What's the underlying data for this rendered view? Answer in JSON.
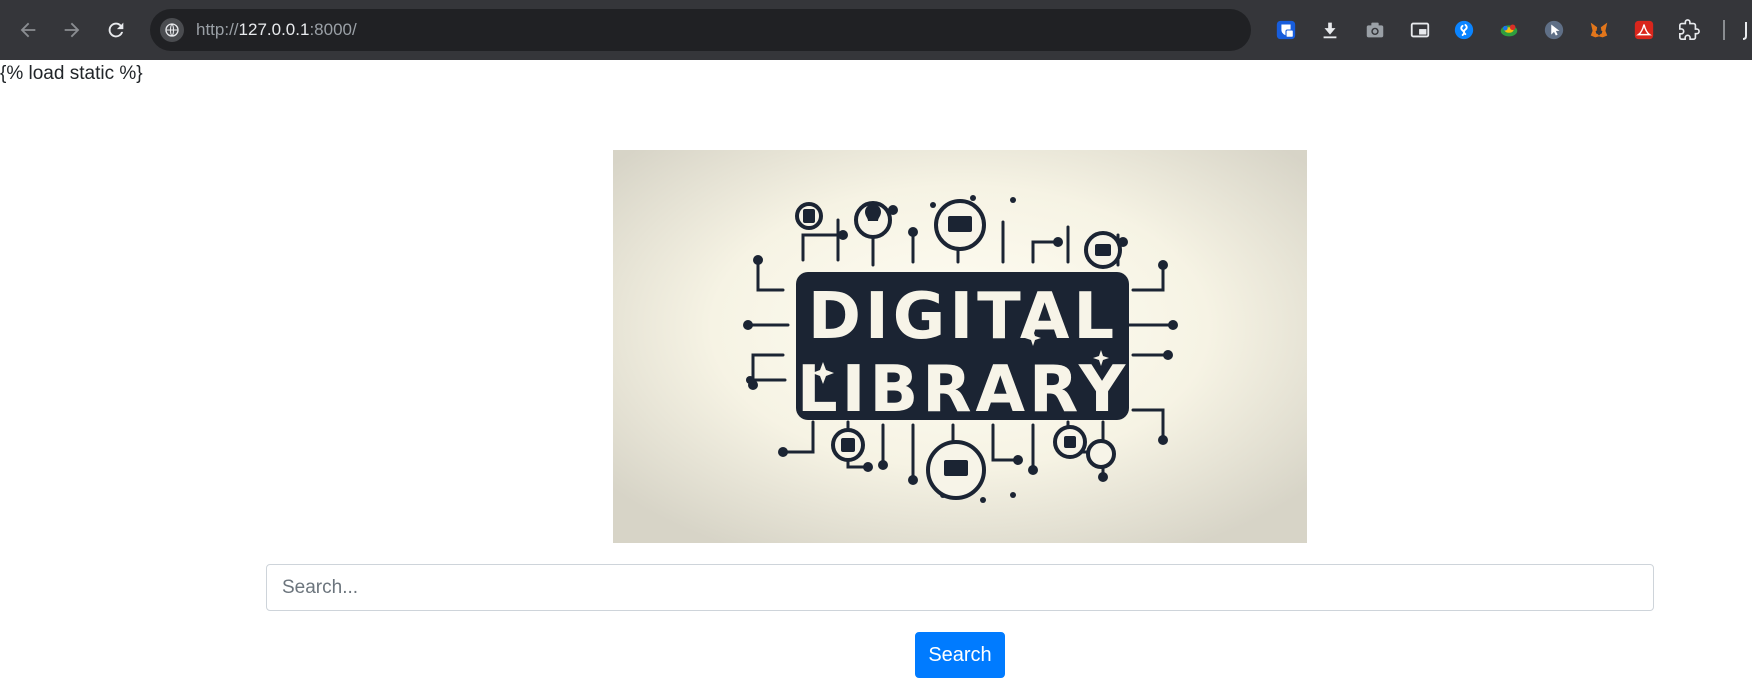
{
  "browser": {
    "url_scheme": "http://",
    "url_host": "127.0.0.1",
    "url_rest": ":8000/",
    "extensions": [
      "bitwarden-icon",
      "download-icon",
      "camera-icon",
      "picture-in-picture-icon",
      "shazam-icon",
      "colorzilla-icon",
      "cursor-icon",
      "metamask-icon",
      "acrobat-icon",
      "extensions-puzzle-icon"
    ]
  },
  "page": {
    "template_tag": "{% load static %}",
    "hero": {
      "line1": "DIGITAL",
      "line2": "LIBRARY"
    },
    "search": {
      "placeholder": "Search...",
      "value": "",
      "button_label": "Search"
    }
  },
  "colors": {
    "chrome_bg": "#35363a",
    "omnibox_bg": "#202124",
    "primary": "#007bff",
    "logo_dark": "#1b2433",
    "logo_bg": "#f7f4e8"
  }
}
